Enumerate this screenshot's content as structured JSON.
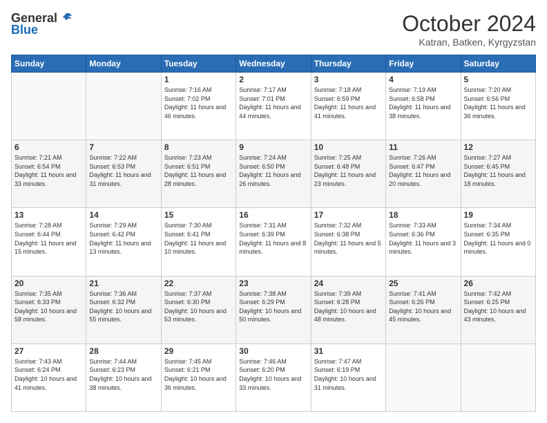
{
  "logo": {
    "general": "General",
    "blue": "Blue"
  },
  "title": "October 2024",
  "subtitle": "Katran, Batken, Kyrgyzstan",
  "days_of_week": [
    "Sunday",
    "Monday",
    "Tuesday",
    "Wednesday",
    "Thursday",
    "Friday",
    "Saturday"
  ],
  "weeks": [
    [
      {
        "day": "",
        "info": ""
      },
      {
        "day": "",
        "info": ""
      },
      {
        "day": "1",
        "info": "Sunrise: 7:16 AM\nSunset: 7:02 PM\nDaylight: 11 hours and 46 minutes."
      },
      {
        "day": "2",
        "info": "Sunrise: 7:17 AM\nSunset: 7:01 PM\nDaylight: 11 hours and 44 minutes."
      },
      {
        "day": "3",
        "info": "Sunrise: 7:18 AM\nSunset: 6:59 PM\nDaylight: 11 hours and 41 minutes."
      },
      {
        "day": "4",
        "info": "Sunrise: 7:19 AM\nSunset: 6:58 PM\nDaylight: 11 hours and 38 minutes."
      },
      {
        "day": "5",
        "info": "Sunrise: 7:20 AM\nSunset: 6:56 PM\nDaylight: 11 hours and 36 minutes."
      }
    ],
    [
      {
        "day": "6",
        "info": "Sunrise: 7:21 AM\nSunset: 6:54 PM\nDaylight: 11 hours and 33 minutes."
      },
      {
        "day": "7",
        "info": "Sunrise: 7:22 AM\nSunset: 6:53 PM\nDaylight: 11 hours and 31 minutes."
      },
      {
        "day": "8",
        "info": "Sunrise: 7:23 AM\nSunset: 6:51 PM\nDaylight: 11 hours and 28 minutes."
      },
      {
        "day": "9",
        "info": "Sunrise: 7:24 AM\nSunset: 6:50 PM\nDaylight: 11 hours and 26 minutes."
      },
      {
        "day": "10",
        "info": "Sunrise: 7:25 AM\nSunset: 6:48 PM\nDaylight: 11 hours and 23 minutes."
      },
      {
        "day": "11",
        "info": "Sunrise: 7:26 AM\nSunset: 6:47 PM\nDaylight: 11 hours and 20 minutes."
      },
      {
        "day": "12",
        "info": "Sunrise: 7:27 AM\nSunset: 6:45 PM\nDaylight: 11 hours and 18 minutes."
      }
    ],
    [
      {
        "day": "13",
        "info": "Sunrise: 7:28 AM\nSunset: 6:44 PM\nDaylight: 11 hours and 15 minutes."
      },
      {
        "day": "14",
        "info": "Sunrise: 7:29 AM\nSunset: 6:42 PM\nDaylight: 11 hours and 13 minutes."
      },
      {
        "day": "15",
        "info": "Sunrise: 7:30 AM\nSunset: 6:41 PM\nDaylight: 11 hours and 10 minutes."
      },
      {
        "day": "16",
        "info": "Sunrise: 7:31 AM\nSunset: 6:39 PM\nDaylight: 11 hours and 8 minutes."
      },
      {
        "day": "17",
        "info": "Sunrise: 7:32 AM\nSunset: 6:38 PM\nDaylight: 11 hours and 5 minutes."
      },
      {
        "day": "18",
        "info": "Sunrise: 7:33 AM\nSunset: 6:36 PM\nDaylight: 11 hours and 3 minutes."
      },
      {
        "day": "19",
        "info": "Sunrise: 7:34 AM\nSunset: 6:35 PM\nDaylight: 11 hours and 0 minutes."
      }
    ],
    [
      {
        "day": "20",
        "info": "Sunrise: 7:35 AM\nSunset: 6:33 PM\nDaylight: 10 hours and 58 minutes."
      },
      {
        "day": "21",
        "info": "Sunrise: 7:36 AM\nSunset: 6:32 PM\nDaylight: 10 hours and 55 minutes."
      },
      {
        "day": "22",
        "info": "Sunrise: 7:37 AM\nSunset: 6:30 PM\nDaylight: 10 hours and 53 minutes."
      },
      {
        "day": "23",
        "info": "Sunrise: 7:38 AM\nSunset: 6:29 PM\nDaylight: 10 hours and 50 minutes."
      },
      {
        "day": "24",
        "info": "Sunrise: 7:39 AM\nSunset: 6:28 PM\nDaylight: 10 hours and 48 minutes."
      },
      {
        "day": "25",
        "info": "Sunrise: 7:41 AM\nSunset: 6:26 PM\nDaylight: 10 hours and 45 minutes."
      },
      {
        "day": "26",
        "info": "Sunrise: 7:42 AM\nSunset: 6:25 PM\nDaylight: 10 hours and 43 minutes."
      }
    ],
    [
      {
        "day": "27",
        "info": "Sunrise: 7:43 AM\nSunset: 6:24 PM\nDaylight: 10 hours and 41 minutes."
      },
      {
        "day": "28",
        "info": "Sunrise: 7:44 AM\nSunset: 6:23 PM\nDaylight: 10 hours and 38 minutes."
      },
      {
        "day": "29",
        "info": "Sunrise: 7:45 AM\nSunset: 6:21 PM\nDaylight: 10 hours and 36 minutes."
      },
      {
        "day": "30",
        "info": "Sunrise: 7:46 AM\nSunset: 6:20 PM\nDaylight: 10 hours and 33 minutes."
      },
      {
        "day": "31",
        "info": "Sunrise: 7:47 AM\nSunset: 6:19 PM\nDaylight: 10 hours and 31 minutes."
      },
      {
        "day": "",
        "info": ""
      },
      {
        "day": "",
        "info": ""
      }
    ]
  ]
}
